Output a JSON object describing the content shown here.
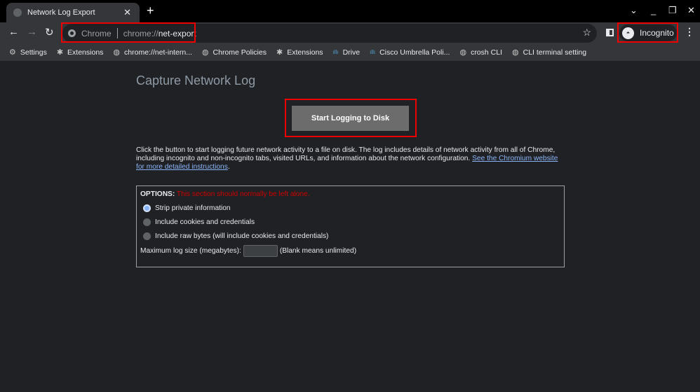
{
  "tab": {
    "title": "Network Log Export",
    "close": "✕",
    "new_tab": "+"
  },
  "window_controls": {
    "dropdown": "⌄",
    "minimize": "_",
    "restore": "❐",
    "close": "✕"
  },
  "nav": {
    "back": "←",
    "forward": "→",
    "reload": "↻"
  },
  "omnibox": {
    "site": "Chrome",
    "url_prefix": "chrome://",
    "url_host": "net-export",
    "star": "☆"
  },
  "profile": {
    "label": "Incognito",
    "menu": "⋮"
  },
  "bookmarks": [
    {
      "label": "Settings",
      "icon": "gear-icon",
      "glyph": "⚙"
    },
    {
      "label": "Extensions",
      "icon": "puzzle-icon",
      "glyph": "✱"
    },
    {
      "label": "chrome://net-intern...",
      "icon": "globe-icon",
      "glyph": "◍"
    },
    {
      "label": "Chrome Policies",
      "icon": "globe-icon",
      "glyph": "◍"
    },
    {
      "label": "Extensions",
      "icon": "puzzle-icon",
      "glyph": "✱"
    },
    {
      "label": "Drive",
      "icon": "cisco-icon",
      "glyph": "ıllı"
    },
    {
      "label": "Cisco Umbrella Poli...",
      "icon": "cisco-icon",
      "glyph": "ıllı"
    },
    {
      "label": "crosh CLI",
      "icon": "globe-icon",
      "glyph": "◍"
    },
    {
      "label": "CLI terminal setting",
      "icon": "globe-icon",
      "glyph": "◍"
    }
  ],
  "page": {
    "title": "Capture Network Log",
    "start_button": "Start Logging to Disk",
    "description": "Click the button to start logging future network activity to a file on disk. The log includes details of network activity from all of Chrome, including incognito and non-incognito tabs, visited URLs, and information about the network configuration.",
    "link": "See the Chromium website for more detailed instructions",
    "link_suffix": ".",
    "options_label": "OPTIONS:",
    "options_warning": "This section should normally be left alone.",
    "options": [
      {
        "label": "Strip private information",
        "selected": true
      },
      {
        "label": "Include cookies and credentials",
        "selected": false
      },
      {
        "label": "Include raw bytes (will include cookies and credentials)",
        "selected": false
      }
    ],
    "max_size_label": "Maximum log size (megabytes):",
    "max_size_value": "",
    "max_size_hint": "(Blank means unlimited)"
  }
}
